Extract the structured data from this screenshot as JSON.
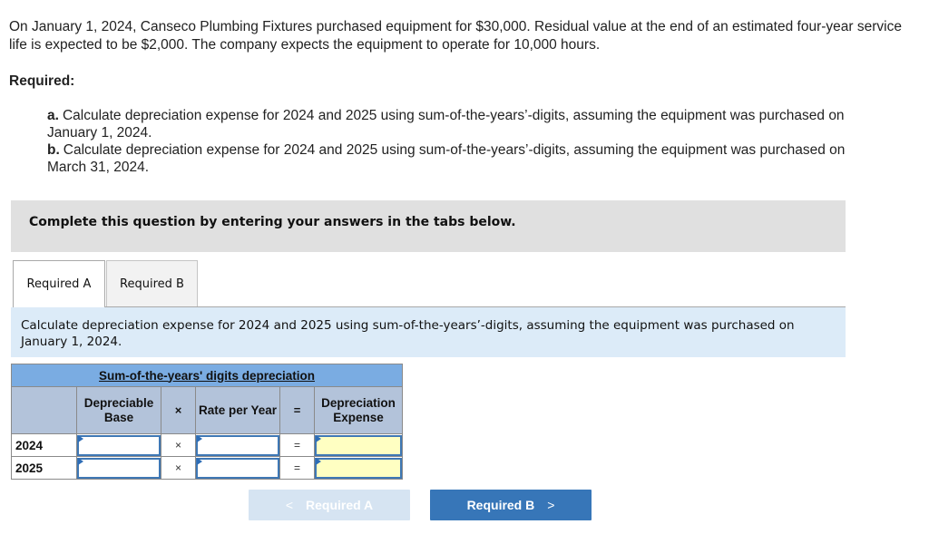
{
  "problem": {
    "intro": "On January 1, 2024, Canseco Plumbing Fixtures purchased equipment for $30,000. Residual value at the end of an estimated four-year service life is expected to be $2,000. The company expects the equipment to operate for 10,000 hours.",
    "required_label": "Required:",
    "requirements": [
      {
        "letter": "a.",
        "text": "Calculate depreciation expense for 2024 and 2025 using sum-of-the-years’-digits, assuming the equipment was purchased on",
        "cont": "January 1, 2024."
      },
      {
        "letter": "b.",
        "text": "Calculate depreciation expense for 2024 and 2025 using sum-of-the-years’-digits, assuming the equipment was purchased on",
        "cont": "March 31, 2024."
      }
    ]
  },
  "instructions_box": "Complete this question by entering your answers in the tabs below.",
  "tabs": [
    {
      "label": "Required A",
      "active": true
    },
    {
      "label": "Required B",
      "active": false
    }
  ],
  "panel_instruction": "Calculate depreciation expense for 2024 and 2025 using sum-of-the-years’-digits, assuming the equipment was purchased on January 1, 2024.",
  "table": {
    "title": "Sum-of-the-years' digits depreciation",
    "headers": {
      "depreciable_base": "Depreciable Base",
      "times": "×",
      "rate_per_year": "Rate per Year",
      "equals": "=",
      "depreciation_expense": "Depreciation Expense"
    },
    "rows": [
      {
        "year": "2024",
        "depreciable_base": "",
        "times": "×",
        "rate_per_year": "",
        "equals": "=",
        "depreciation_expense": ""
      },
      {
        "year": "2025",
        "depreciable_base": "",
        "times": "×",
        "rate_per_year": "",
        "equals": "=",
        "depreciation_expense": ""
      }
    ]
  },
  "navigation": {
    "prev_label": "Required A",
    "prev_icon": "chevron-left-icon",
    "prev_chevron": "<",
    "next_label": "Required B",
    "next_icon": "chevron-right-icon",
    "next_chevron": ">"
  },
  "colors": {
    "title_row": "#7aace2",
    "header_row": "#b3c3da",
    "input_border": "#3f78b5",
    "computed_cell": "#ffffc2",
    "next_button": "#3776b8",
    "prev_button_disabled": "#d6e4f2",
    "panel_background": "#dcebf8",
    "instruction_box": "#e0e0e0"
  }
}
